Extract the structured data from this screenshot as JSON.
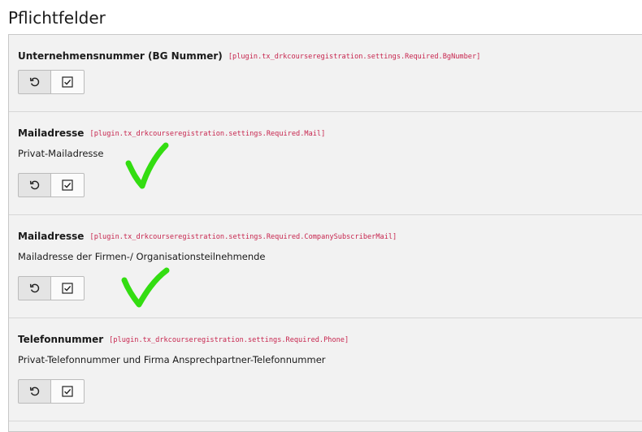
{
  "page": {
    "title": "Pflichtfelder"
  },
  "fields": [
    {
      "label": "Unternehmensnummer (BG Nummer)",
      "key": "[plugin.tx_drkcourseregistration.settings.Required.BgNumber]",
      "description": ""
    },
    {
      "label": "Mailadresse",
      "key": "[plugin.tx_drkcourseregistration.settings.Required.Mail]",
      "description": "Privat-Mailadresse"
    },
    {
      "label": "Mailadresse",
      "key": "[plugin.tx_drkcourseregistration.settings.Required.CompanySubscriberMail]",
      "description": "Mailadresse der Firmen-/ Organisationsteilnehmende"
    },
    {
      "label": "Telefonnummer",
      "key": "[plugin.tx_drkcourseregistration.settings.Required.Phone]",
      "description": "Privat-Telefonnummer und Firma Ansprechpartner-Telefonnummer"
    }
  ],
  "icons": {
    "reset": "undo-icon",
    "checkbox": "checkbox-checked-icon",
    "annotation": "green-checkmark-icon"
  },
  "colors": {
    "key_text": "#c7254e",
    "annotation": "#33dd11",
    "panel_background": "#f2f2f2"
  }
}
